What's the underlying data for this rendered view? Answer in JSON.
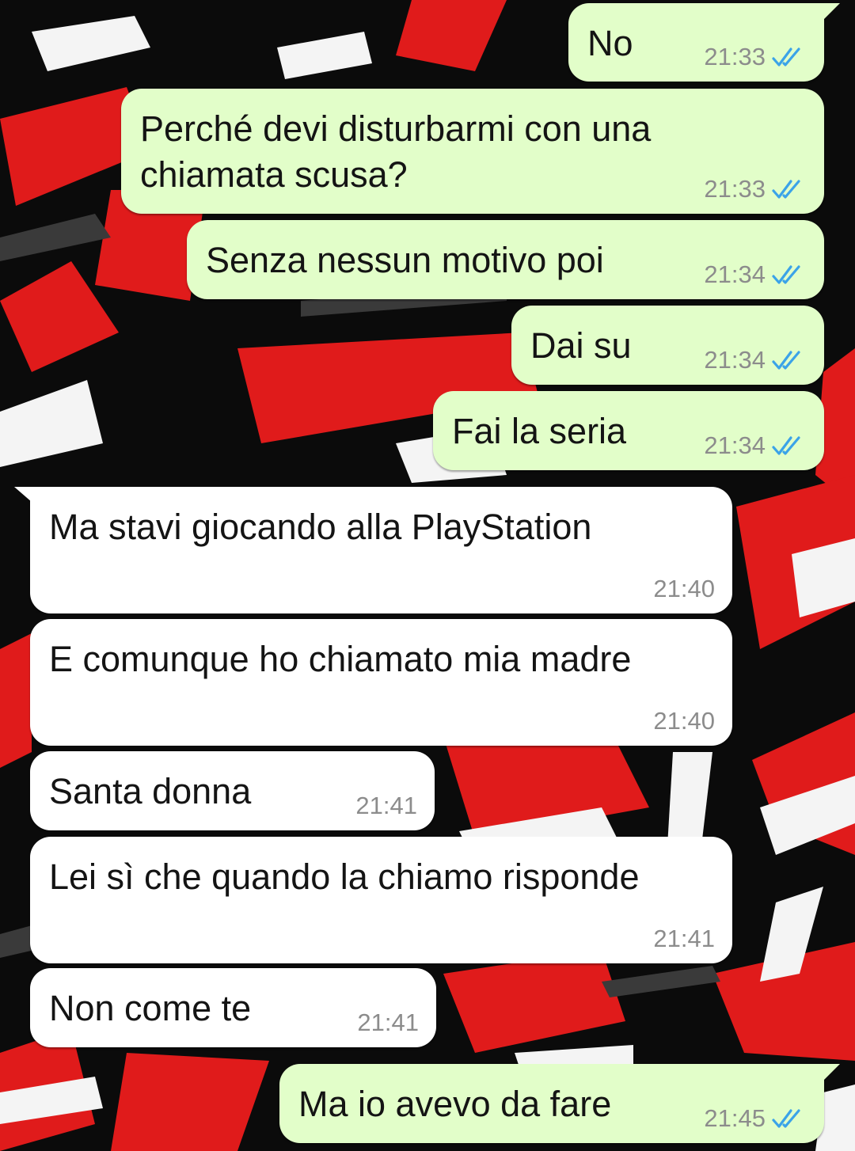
{
  "colors": {
    "outgoing_bubble": "#e2fec9",
    "incoming_bubble": "#ffffff",
    "read_ticks": "#3ba3e8",
    "timestamp": "#8c8c8c",
    "wallpaper_black": "#0b0b0b",
    "wallpaper_red": "#e01b1b",
    "wallpaper_white": "#f4f4f4"
  },
  "messages": [
    {
      "direction": "outgoing",
      "text": "No",
      "time": "21:33",
      "status_icon": "double-check-read-icon"
    },
    {
      "direction": "outgoing",
      "text": "Perché devi disturbarmi con una\nchiamata scusa?",
      "time": "21:33",
      "status_icon": "double-check-read-icon"
    },
    {
      "direction": "outgoing",
      "text": "Senza nessun motivo poi",
      "time": "21:34",
      "status_icon": "double-check-read-icon"
    },
    {
      "direction": "outgoing",
      "text": "Dai su",
      "time": "21:34",
      "status_icon": "double-check-read-icon"
    },
    {
      "direction": "outgoing",
      "text": "Fai la seria",
      "time": "21:34",
      "status_icon": "double-check-read-icon"
    },
    {
      "direction": "incoming",
      "text": "Ma stavi giocando alla PlayStation",
      "time": "21:40"
    },
    {
      "direction": "incoming",
      "text": "E comunque ho chiamato mia madre",
      "time": "21:40"
    },
    {
      "direction": "incoming",
      "text": "Santa donna",
      "time": "21:41"
    },
    {
      "direction": "incoming",
      "text": "Lei sì che quando la chiamo risponde",
      "time": "21:41"
    },
    {
      "direction": "incoming",
      "text": "Non come te",
      "time": "21:41"
    },
    {
      "direction": "outgoing",
      "text": "Ma io avevo da fare",
      "time": "21:45",
      "status_icon": "double-check-read-icon"
    }
  ]
}
